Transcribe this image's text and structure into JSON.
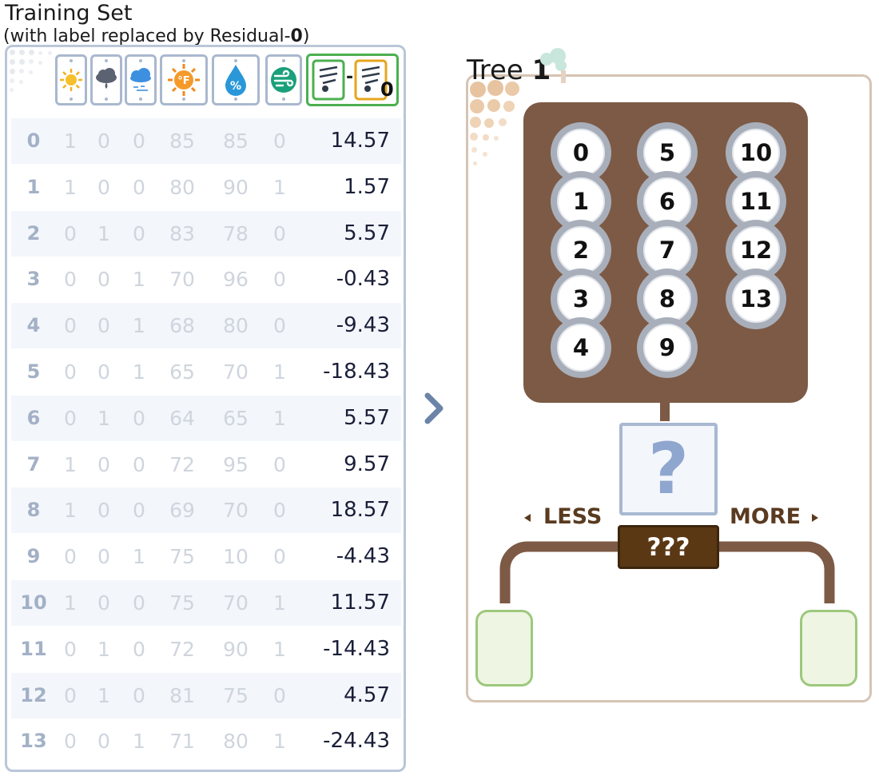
{
  "training_set": {
    "title": "Training Set",
    "subtitle_prefix": "(with label replaced by Residual-",
    "subtitle_index": "0",
    "subtitle_suffix": ")",
    "feature_icons": [
      "sunny-icon",
      "cloudy-rain-icon",
      "rain-wind-icon",
      "temperature-fahrenheit-icon",
      "humidity-drop-icon",
      "wind-icon"
    ],
    "residual_header": {
      "minus": "-",
      "subscript": "0"
    },
    "rows": [
      {
        "index": "0",
        "features": [
          "1",
          "0",
          "0",
          "85",
          "85",
          "0"
        ],
        "residual": "14.57"
      },
      {
        "index": "1",
        "features": [
          "1",
          "0",
          "0",
          "80",
          "90",
          "1"
        ],
        "residual": "1.57"
      },
      {
        "index": "2",
        "features": [
          "0",
          "1",
          "0",
          "83",
          "78",
          "0"
        ],
        "residual": "5.57"
      },
      {
        "index": "3",
        "features": [
          "0",
          "0",
          "1",
          "70",
          "96",
          "0"
        ],
        "residual": "-0.43"
      },
      {
        "index": "4",
        "features": [
          "0",
          "0",
          "1",
          "68",
          "80",
          "0"
        ],
        "residual": "-9.43"
      },
      {
        "index": "5",
        "features": [
          "0",
          "0",
          "1",
          "65",
          "70",
          "1"
        ],
        "residual": "-18.43"
      },
      {
        "index": "6",
        "features": [
          "0",
          "1",
          "0",
          "64",
          "65",
          "1"
        ],
        "residual": "5.57"
      },
      {
        "index": "7",
        "features": [
          "1",
          "0",
          "0",
          "72",
          "95",
          "0"
        ],
        "residual": "9.57"
      },
      {
        "index": "8",
        "features": [
          "1",
          "0",
          "0",
          "69",
          "70",
          "0"
        ],
        "residual": "18.57"
      },
      {
        "index": "9",
        "features": [
          "0",
          "0",
          "1",
          "75",
          "10",
          "0"
        ],
        "residual": "-4.43"
      },
      {
        "index": "10",
        "features": [
          "1",
          "0",
          "0",
          "75",
          "70",
          "1"
        ],
        "residual": "11.57"
      },
      {
        "index": "11",
        "features": [
          "0",
          "1",
          "0",
          "72",
          "90",
          "1"
        ],
        "residual": "-14.43"
      },
      {
        "index": "12",
        "features": [
          "0",
          "1",
          "0",
          "81",
          "75",
          "0"
        ],
        "residual": "4.57"
      },
      {
        "index": "13",
        "features": [
          "0",
          "0",
          "1",
          "71",
          "80",
          "1"
        ],
        "residual": "-24.43"
      }
    ]
  },
  "arrow_icon": "chevron-right-icon",
  "tree": {
    "title": "Tree ",
    "number": "1",
    "samples": [
      [
        "0",
        "1",
        "2",
        "3",
        "4"
      ],
      [
        "5",
        "6",
        "7",
        "8",
        "9"
      ],
      [
        "10",
        "11",
        "12",
        "13"
      ]
    ],
    "question_mark": "?",
    "less_label": "LESS",
    "more_label": "MORE",
    "split_label": "???"
  },
  "colors": {
    "residual_frame": "#4caf50",
    "node_brown": "#7d5a45",
    "leaf_fill": "#eef5e2",
    "leaf_border": "#9ec87d",
    "question_blue": "#8fa6cf"
  }
}
